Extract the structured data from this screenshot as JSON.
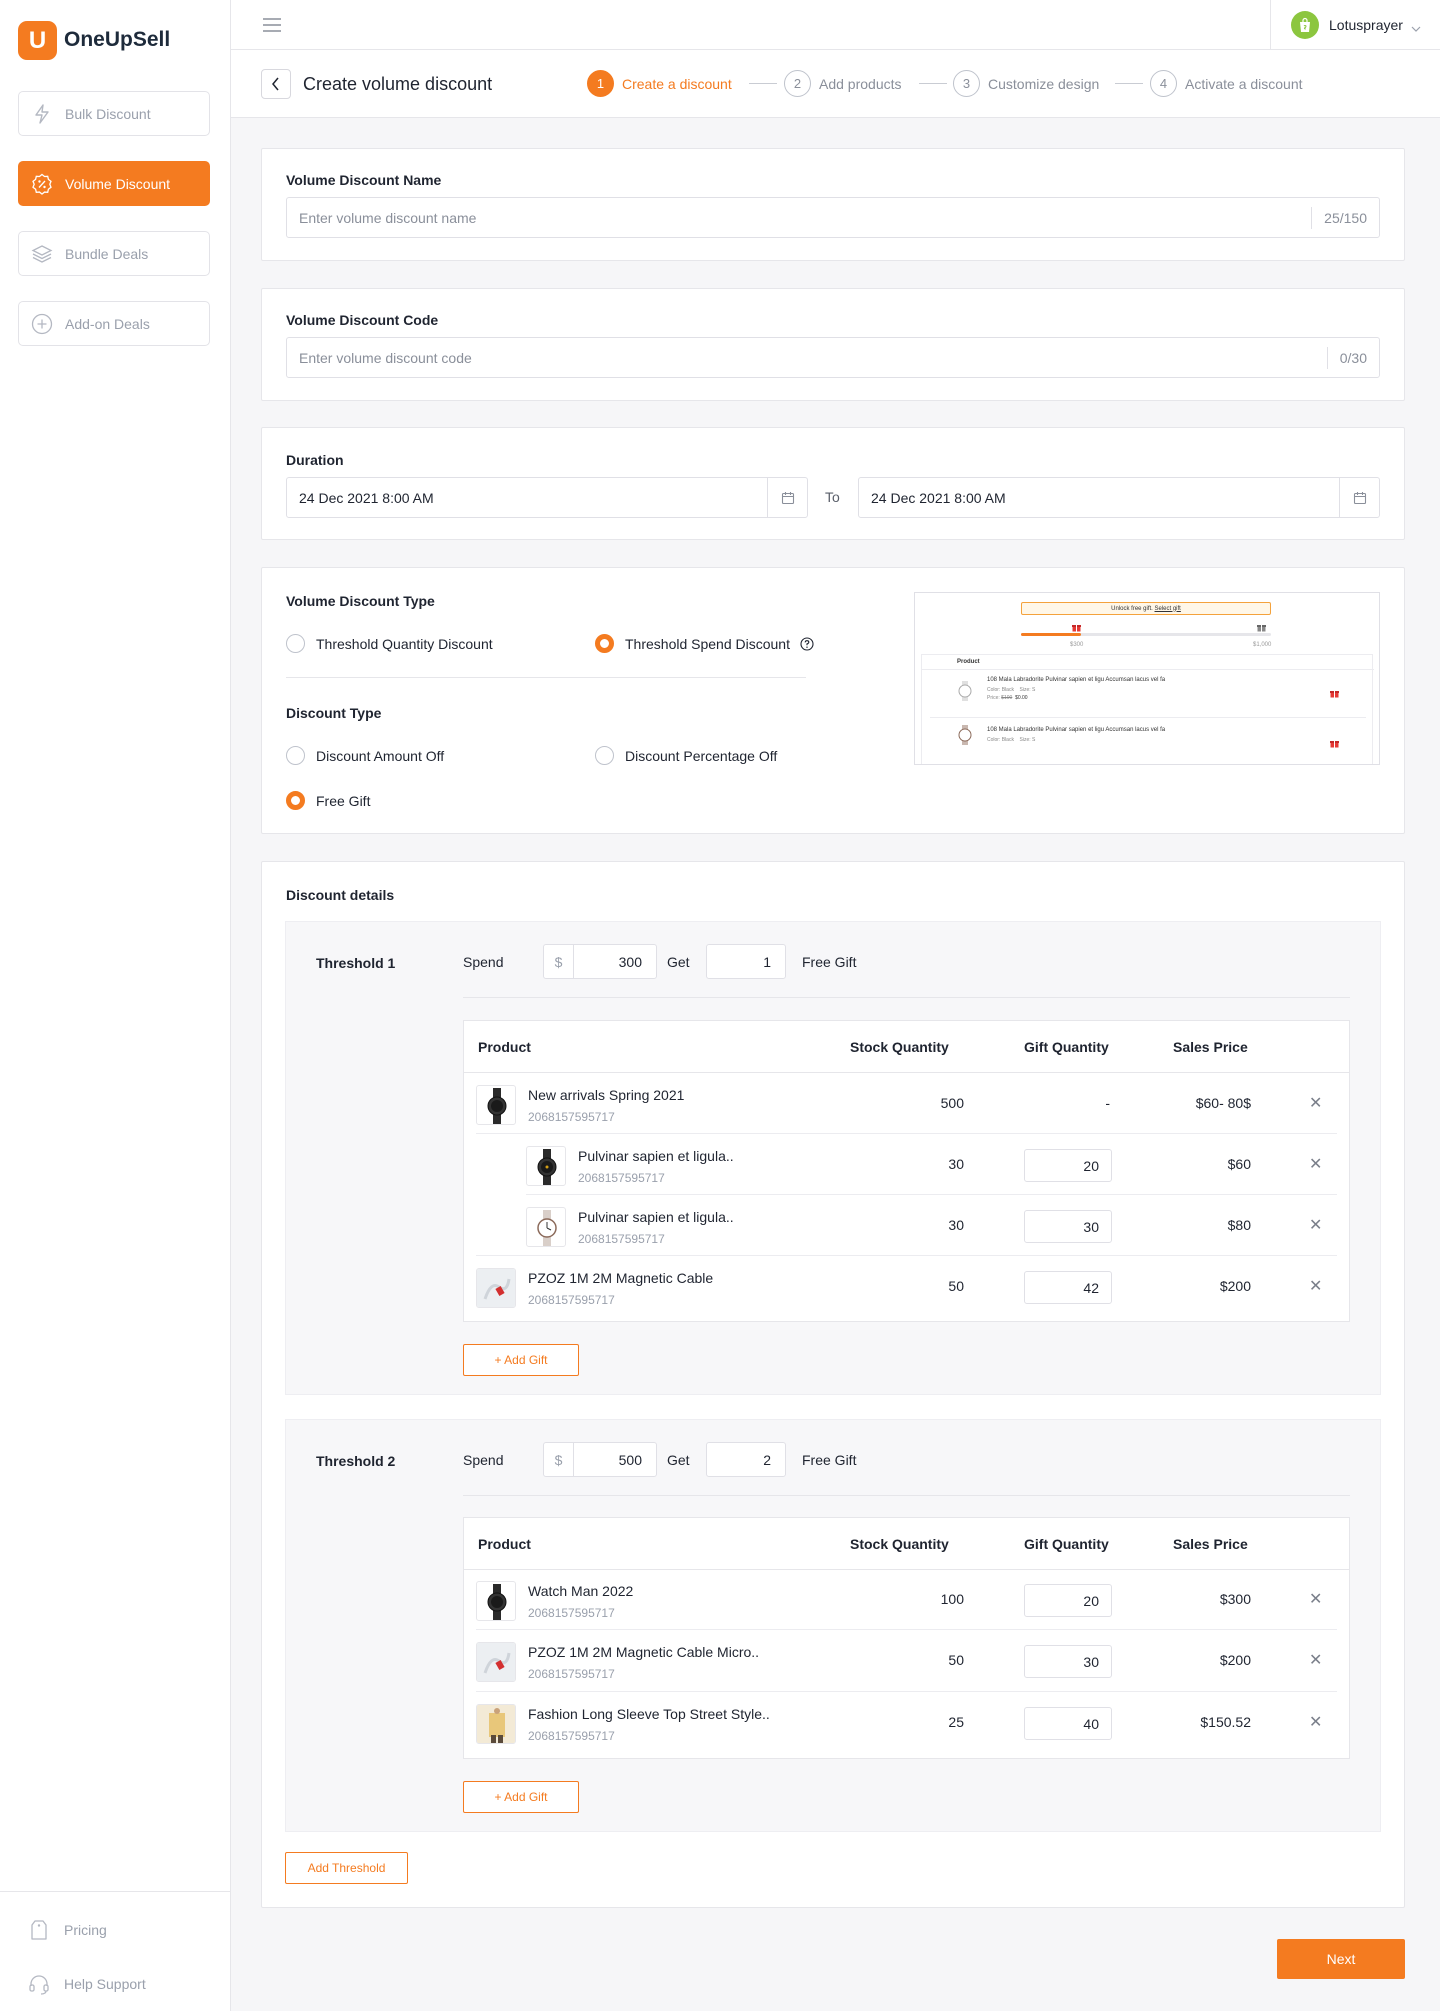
{
  "app": {
    "name": "OneUpSell",
    "logo_letter": "U",
    "accent": "#f47b20"
  },
  "sidebar": {
    "items": [
      {
        "label": "Bulk Discount",
        "icon": "bolt-icon"
      },
      {
        "label": "Volume Discount",
        "icon": "percent-badge-icon",
        "active": true
      },
      {
        "label": "Bundle Deals",
        "icon": "layers-icon"
      },
      {
        "label": "Add-on Deals",
        "icon": "plus-circle-icon"
      }
    ],
    "footer": [
      {
        "label": "Pricing",
        "icon": "tag-icon"
      },
      {
        "label": "Help Support",
        "icon": "headset-icon"
      }
    ]
  },
  "topbar": {
    "user": "Lotusprayer",
    "menu_icon": "hamburger-icon"
  },
  "header": {
    "title": "Create volume discount",
    "steps": [
      {
        "num": "1",
        "label": "Create a discount",
        "active": true
      },
      {
        "num": "2",
        "label": "Add products"
      },
      {
        "num": "3",
        "label": "Customize design"
      },
      {
        "num": "4",
        "label": "Activate a discount"
      }
    ]
  },
  "name_card": {
    "label": "Volume Discount Name",
    "placeholder": "Enter volume discount name",
    "counter": "25/150"
  },
  "code_card": {
    "label": "Volume Discount Code",
    "placeholder": "Enter volume discount code",
    "counter": "0/30"
  },
  "duration": {
    "label": "Duration",
    "start": "24 Dec 2021 8:00 AM",
    "to": "To",
    "end": "24 Dec 2021 8:00 AM"
  },
  "type_card": {
    "volume_type_label": "Volume Discount Type",
    "volume_options": [
      "Threshold Quantity Discount",
      "Threshold Spend Discount"
    ],
    "volume_selected": 1,
    "discount_type_label": "Discount Type",
    "discount_options": [
      "Discount Amount Off",
      "Discount Percentage Off",
      "Free Gift"
    ],
    "discount_selected": 2,
    "preview": {
      "banner": "Unlock free gift.",
      "banner_link": "Select gift",
      "tick_min": "$300",
      "tick_max": "$1,000",
      "product_header": "Product",
      "item_name": "108 Mala Labradorite Pulvinar sapien et ligu Accumsan lacus vel fa",
      "item_color": "Color: Black",
      "item_size": "Size: S",
      "item_price_label": "Price:",
      "item_old_price": "$100",
      "item_new_price": "$0.00"
    }
  },
  "details": {
    "label": "Discount details",
    "columns": [
      "Product",
      "Stock Quantity",
      "Gift Quantity",
      "Sales Price"
    ],
    "spend_label": "Spend",
    "get_label": "Get",
    "free_gift_label": "Free Gift",
    "currency": "$",
    "add_gift": "+ Add Gift",
    "add_threshold": "Add Threshold",
    "thresholds": [
      {
        "label": "Threshold 1",
        "spend": "300",
        "get": "1",
        "rows": [
          {
            "name": "New arrivals Spring 2021",
            "sku": "2068157595717",
            "stock": "500",
            "gift": "-",
            "price": "$60- 80$",
            "thumb": "watch-black"
          },
          {
            "name": "Pulvinar sapien et ligula..",
            "sku": "2068157595717",
            "stock": "30",
            "gift": "20",
            "price": "$60",
            "thumb": "watch-black",
            "child": true
          },
          {
            "name": "Pulvinar sapien et ligula..",
            "sku": "2068157595717",
            "stock": "30",
            "gift": "30",
            "price": "$80",
            "thumb": "watch-white",
            "child": true
          },
          {
            "name": "PZOZ 1M 2M Magnetic Cable",
            "sku": "2068157595717",
            "stock": "50",
            "gift": "42",
            "price": "$200",
            "thumb": "cable"
          }
        ]
      },
      {
        "label": "Threshold 2",
        "spend": "500",
        "get": "2",
        "rows": [
          {
            "name": "Watch Man 2022",
            "sku": "2068157595717",
            "stock": "100",
            "gift": "20",
            "price": "$300",
            "thumb": "watch-black"
          },
          {
            "name": "PZOZ 1M 2M Magnetic Cable Micro..",
            "sku": "2068157595717",
            "stock": "50",
            "gift": "30",
            "price": "$200",
            "thumb": "cable"
          },
          {
            "name": "Fashion Long Sleeve Top Street Style..",
            "sku": "2068157595717",
            "stock": "25",
            "gift": "40",
            "price": "$150.52",
            "thumb": "fashion"
          }
        ]
      }
    ]
  },
  "next_label": "Next"
}
